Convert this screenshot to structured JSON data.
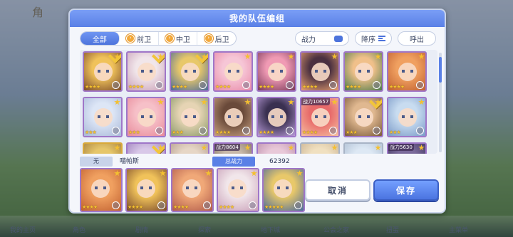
{
  "background": {
    "logo_text": "角",
    "bottom_labels": [
      "我的主页",
      "角色",
      "剧情",
      "探索",
      "地下城",
      "公会之家",
      "扭蛋",
      "主菜单"
    ]
  },
  "dialog": {
    "title": "我的队伍编组"
  },
  "filters": {
    "tabs": [
      {
        "label": "全部",
        "active": true
      },
      {
        "label": "前卫",
        "active": false
      },
      {
        "label": "中卫",
        "active": false
      },
      {
        "label": "后卫",
        "active": false
      }
    ],
    "sort_key_label": "战力",
    "order_label": "降序",
    "call_label": "呼出"
  },
  "roster_rows": [
    [
      {
        "palette": [
          "#f0c25a",
          "#7a4a2a"
        ],
        "checked": true,
        "stars": "★★★★",
        "frame": "purple"
      },
      {
        "palette": [
          "#f1e6ea",
          "#c9a0b8"
        ],
        "checked": true,
        "stars": "★★★★",
        "frame": "purple"
      },
      {
        "palette": [
          "#e8c86a",
          "#4a6a9a"
        ],
        "checked": true,
        "stars": "★★★★",
        "frame": "purple"
      },
      {
        "palette": [
          "#f6c6d6",
          "#e88aa8"
        ],
        "checked": false,
        "stars": "★★★★",
        "frame": "purple"
      },
      {
        "palette": [
          "#f09ab4",
          "#7a3a5a"
        ],
        "checked": false,
        "stars": "★★★★",
        "frame": "purple"
      },
      {
        "palette": [
          "#4a3040",
          "#e8a070"
        ],
        "checked": false,
        "stars": "★★★★",
        "frame": "purple"
      },
      {
        "palette": [
          "#f0c08a",
          "#4a7a4a"
        ],
        "checked": false,
        "stars": "★★★★",
        "frame": "purple"
      },
      {
        "palette": [
          "#f0a060",
          "#c06030"
        ],
        "checked": false,
        "stars": "★★★★",
        "frame": "purple"
      }
    ],
    [
      {
        "palette": [
          "#dde6f6",
          "#a8b8d8"
        ],
        "checked": false,
        "stars": "★★★",
        "frame": "purple"
      },
      {
        "palette": [
          "#f6c0c8",
          "#e88a9a"
        ],
        "checked": false,
        "stars": "★★★",
        "frame": "purple"
      },
      {
        "palette": [
          "#e6d4b4",
          "#8a9a6a"
        ],
        "checked": false,
        "stars": "★★★",
        "frame": "purple"
      },
      {
        "palette": [
          "#6a4a3a",
          "#c8a080"
        ],
        "checked": false,
        "stars": "★★★★",
        "frame": "purple"
      },
      {
        "palette": [
          "#3a3050",
          "#b89ad8"
        ],
        "checked": false,
        "stars": "★★★★",
        "frame": "purple"
      },
      {
        "palette": [
          "#e86a6a",
          "#f4c0a0"
        ],
        "checked": false,
        "stars": "★★★★",
        "frame": "purple",
        "power": "战力10657"
      },
      {
        "palette": [
          "#e0b890",
          "#7a5a3a"
        ],
        "checked": true,
        "stars": "★★★",
        "frame": "purple"
      },
      {
        "palette": [
          "#c8dcf0",
          "#7a9ac8"
        ],
        "checked": false,
        "stars": "★★★",
        "frame": "purple"
      }
    ],
    [
      {
        "palette": [
          "#e6c66a",
          "#a07a3a"
        ],
        "checked": false,
        "stars": "",
        "frame": "gold"
      },
      {
        "palette": [
          "#d8c8e8",
          "#9a7ab8"
        ],
        "checked": true,
        "stars": "",
        "frame": "purple"
      },
      {
        "palette": [
          "#e6d6c6",
          "#b09a8a"
        ],
        "checked": false,
        "stars": "",
        "frame": "purple"
      },
      {
        "palette": [
          "#c8b8a8",
          "#7a6a5a"
        ],
        "checked": false,
        "stars": "",
        "frame": "purple",
        "power": "战力8604"
      },
      {
        "palette": [
          "#e8c8d8",
          "#b88aa8"
        ],
        "checked": false,
        "stars": "",
        "frame": "purple"
      },
      {
        "palette": [
          "#f0e0c0",
          "#c8b090"
        ],
        "checked": false,
        "stars": "",
        "frame": "silver"
      },
      {
        "palette": [
          "#dde8f4",
          "#aabbd0"
        ],
        "checked": false,
        "stars": "",
        "frame": "silver"
      },
      {
        "palette": [
          "#7a6a9a",
          "#3a3058"
        ],
        "checked": false,
        "stars": "",
        "frame": "purple",
        "power": "战力5630"
      }
    ]
  ],
  "team": {
    "position_badge": "无",
    "team_name": "喵帕斯",
    "total_power_label": "总战力",
    "total_power_value": "62392",
    "members": [
      {
        "palette": [
          "#f0a060",
          "#c06030"
        ],
        "stars": "★★★★"
      },
      {
        "palette": [
          "#f0c25a",
          "#7a4a2a"
        ],
        "stars": "★★★★"
      },
      {
        "palette": [
          "#f0a878",
          "#b05a4a"
        ],
        "stars": "★★★★"
      },
      {
        "palette": [
          "#f1e6ea",
          "#c9a0b8"
        ],
        "stars": "★★★★"
      },
      {
        "palette": [
          "#e8c86a",
          "#4a6a9a"
        ],
        "stars": "★★★★★"
      }
    ]
  },
  "buttons": {
    "cancel": "取消",
    "save": "保存"
  }
}
